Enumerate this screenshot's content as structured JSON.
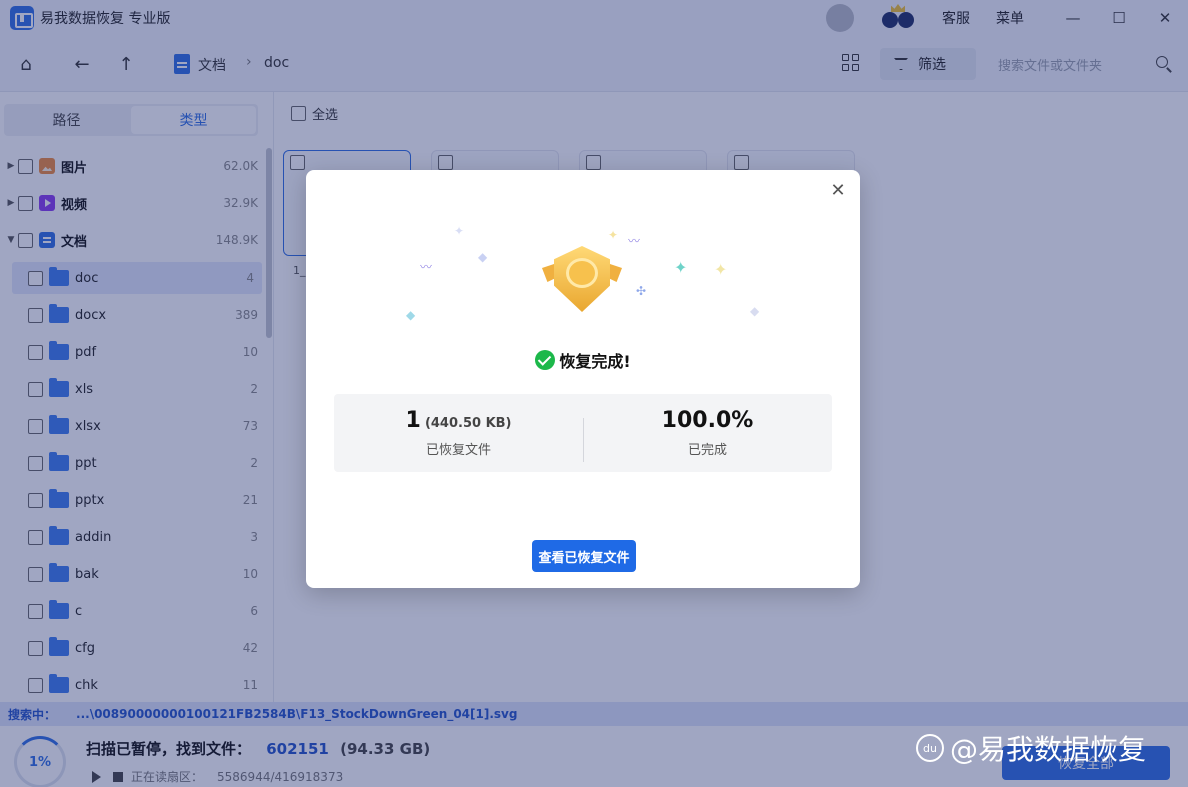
{
  "app": {
    "title": "易我数据恢复 专业版"
  },
  "titlebar": {
    "support": "客服",
    "menu": "菜单",
    "minimize": "—",
    "maximize": "☐",
    "close": "✕"
  },
  "toolbar": {
    "breadcrumb": [
      "文档",
      "doc"
    ],
    "breadcrumb_sep": "›",
    "filter_label": "筛选",
    "search_placeholder": "搜索文件或文件夹"
  },
  "sidebar": {
    "tabs": [
      "路径",
      "类型"
    ],
    "active_tab": "类型",
    "categories": [
      {
        "label": "图片",
        "count": "62.0K",
        "icon": "image-icon"
      },
      {
        "label": "视频",
        "count": "32.9K",
        "icon": "video-icon"
      },
      {
        "label": "文档",
        "count": "148.9K",
        "icon": "document-icon"
      }
    ],
    "folders": [
      {
        "label": "doc",
        "count": "4",
        "selected": true
      },
      {
        "label": "docx",
        "count": "389"
      },
      {
        "label": "pdf",
        "count": "10"
      },
      {
        "label": "xls",
        "count": "2"
      },
      {
        "label": "xlsx",
        "count": "73"
      },
      {
        "label": "ppt",
        "count": "2"
      },
      {
        "label": "pptx",
        "count": "21"
      },
      {
        "label": "addin",
        "count": "3"
      },
      {
        "label": "bak",
        "count": "10"
      },
      {
        "label": "c",
        "count": "6"
      },
      {
        "label": "cfg",
        "count": "42"
      },
      {
        "label": "chk",
        "count": "11"
      }
    ]
  },
  "main": {
    "select_all": "全选",
    "first_file_name": "1_"
  },
  "searchbar": {
    "label": "搜索中：",
    "path": "...\\00890000000100121FB2584B\\F13_StockDownGreen_04[1].svg"
  },
  "scan": {
    "progress": "1%",
    "progress_fraction": 0.01,
    "status": "扫描已暂停，找到文件：",
    "found_count": "602151",
    "found_size": "(94.33 GB)",
    "sector_label": "正在读扇区：",
    "sector_value": "5586944/416918373",
    "recover_all": "恢复全部"
  },
  "dialog": {
    "status": "恢复完成!",
    "recovered_count": "1",
    "recovered_size": "(440.50 KB)",
    "recovered_caption": "已恢复文件",
    "completion": "100.0%",
    "completion_caption": "已完成",
    "view_button": "查看已恢复文件",
    "close": "✕"
  },
  "watermark": {
    "text": "@易我数据恢复",
    "paw": "du"
  },
  "colors": {
    "accent": "#2f6fe4",
    "success": "#1cb84a",
    "overlay": "#1c2a6e"
  }
}
